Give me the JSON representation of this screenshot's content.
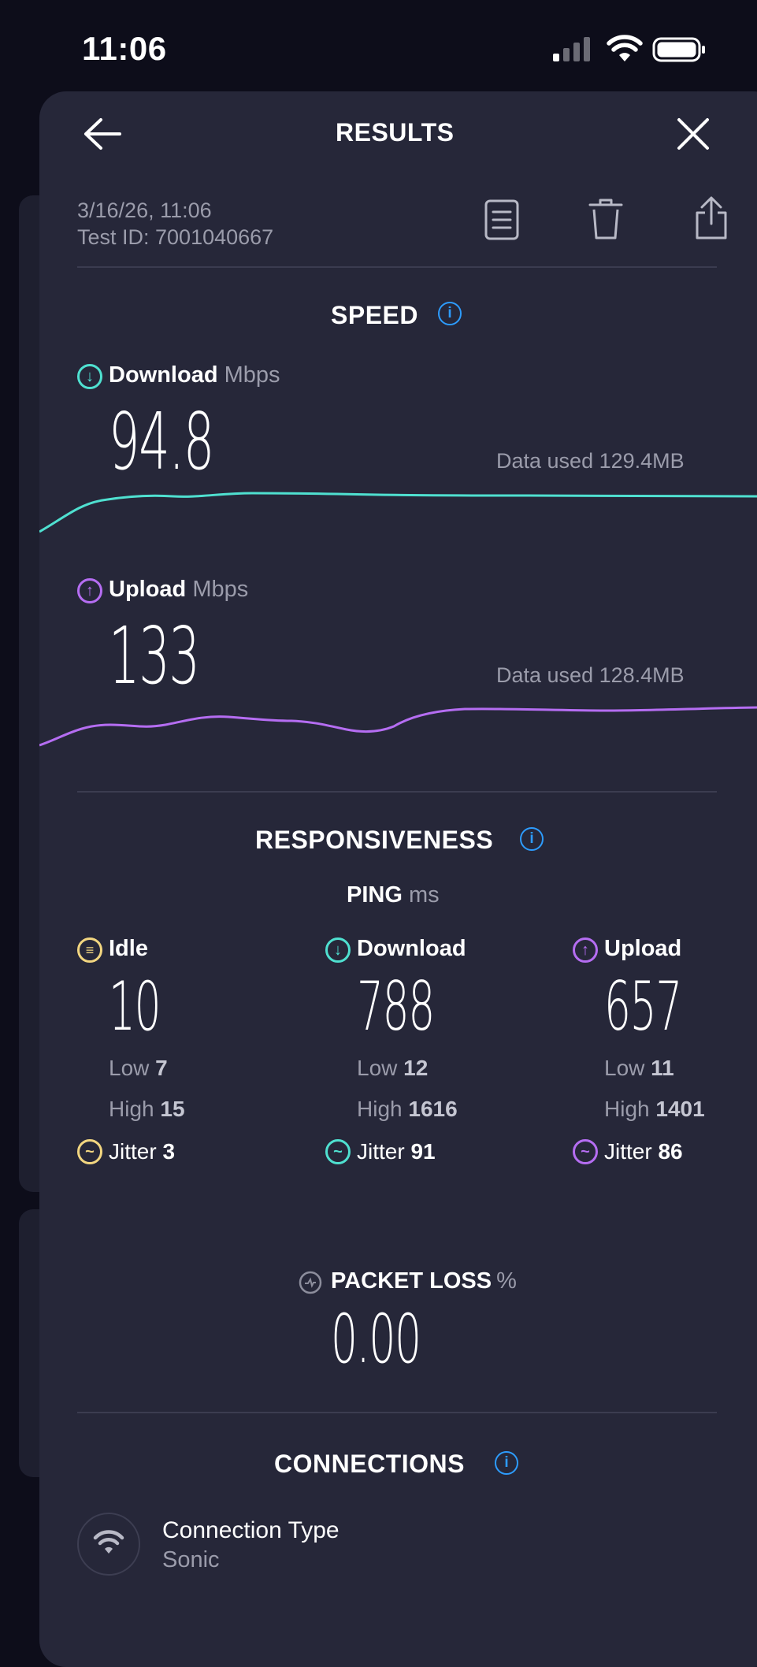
{
  "status_bar": {
    "time": "11:06"
  },
  "header": {
    "title": "RESULTS"
  },
  "meta": {
    "date": "3/16/26, 11:06",
    "test_id": "Test ID: 7001040667"
  },
  "speed": {
    "title": "SPEED",
    "download": {
      "label": "Download",
      "unit": "Mbps",
      "value": "94.8",
      "data_used": "Data used 129.4MB",
      "color": "#4fe0d0"
    },
    "upload": {
      "label": "Upload",
      "unit": "Mbps",
      "value": "133",
      "data_used": "Data used 128.4MB",
      "color": "#b56df2"
    }
  },
  "responsiveness": {
    "title": "RESPONSIVENESS",
    "ping_label": "PING",
    "ping_unit": "ms",
    "idle": {
      "label": "Idle",
      "value": "10",
      "low_label": "Low",
      "low": "7",
      "high_label": "High",
      "high": "15",
      "jitter_label": "Jitter",
      "jitter": "3",
      "color": "#f2d680"
    },
    "download": {
      "label": "Download",
      "value": "788",
      "low_label": "Low",
      "low": "12",
      "high_label": "High",
      "high": "1616",
      "jitter_label": "Jitter",
      "jitter": "91",
      "color": "#4fe0d0"
    },
    "upload": {
      "label": "Upload",
      "value": "657",
      "low_label": "Low",
      "low": "11",
      "high_label": "High",
      "high": "1401",
      "jitter_label": "Jitter",
      "jitter": "86",
      "color": "#b56df2"
    }
  },
  "packet_loss": {
    "label": "PACKET LOSS",
    "unit": "%",
    "value": "0.00"
  },
  "connections": {
    "title": "CONNECTIONS",
    "type_label": "Connection Type",
    "type_value": "Sonic"
  }
}
